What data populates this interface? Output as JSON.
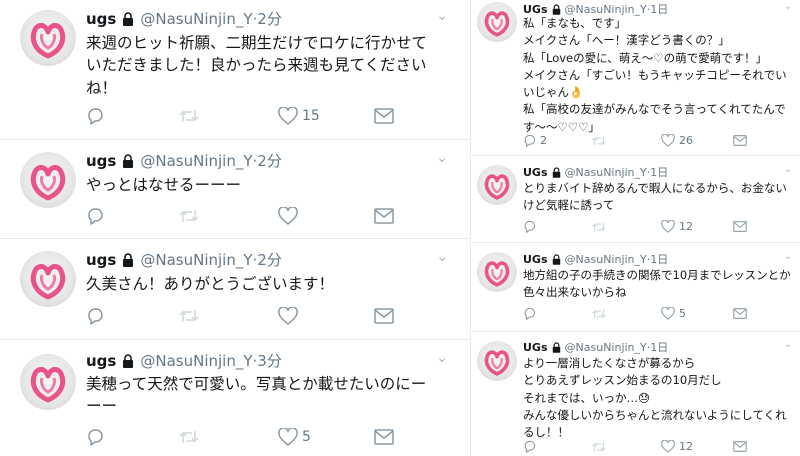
{
  "user": {
    "display_name_left": "ugs",
    "display_name_right": "UGs",
    "handle": "@NasuNinjin_Y",
    "separator": "·",
    "menu_glyph": "⌄"
  },
  "left_tweets": [
    {
      "time": "2分",
      "lines": [
        "来週のヒット祈願、二期生だけでロケに行かせて",
        "いただきました！良かったら来週も見てください",
        "ね！"
      ],
      "like_count": "15"
    },
    {
      "time": "2分",
      "lines": [
        "やっとはなせるーーー"
      ],
      "like_count": ""
    },
    {
      "time": "2分",
      "lines": [
        "久美さん！ありがとうございます！"
      ],
      "like_count": ""
    },
    {
      "time": "3分",
      "lines": [
        "美穂って天然で可愛い。写真とか載せたいのにー",
        "ーー"
      ],
      "like_count": "5"
    }
  ],
  "right_tweets": [
    {
      "time": "1日",
      "lines": [
        "私「まなも、です」",
        "メイクさん「へー！漢字どう書くの？」",
        "私「Loveの愛に、萌え〜♡の萌で愛萌です！」",
        "メイクさん「すごい！もうキャッチコピーそれでい",
        "いじゃん👌",
        "私「高校の友達がみんなでそう言ってくれてたんで",
        "す〜〜♡♡♡」"
      ],
      "reply_count": "2",
      "like_count": "26"
    },
    {
      "time": "1日",
      "lines": [
        "とりまバイト辞めるんで暇人になるから、お金ない",
        "けど気軽に誘って"
      ],
      "reply_count": "",
      "like_count": "12"
    },
    {
      "time": "1日",
      "lines": [
        "地方組の子の手続きの関係で10月までレッスンとか",
        "色々出来ないからね"
      ],
      "reply_count": "",
      "like_count": "5"
    },
    {
      "time": "1日",
      "lines": [
        "より一層消したくなさが募るから",
        "とりあえずレッスン始まるの10月だし",
        "それまでは、いっか…😓",
        "みんな優しいからちゃんと流れないようにしてくれ",
        "るし！！"
      ],
      "reply_count": "",
      "like_count": "12"
    }
  ]
}
